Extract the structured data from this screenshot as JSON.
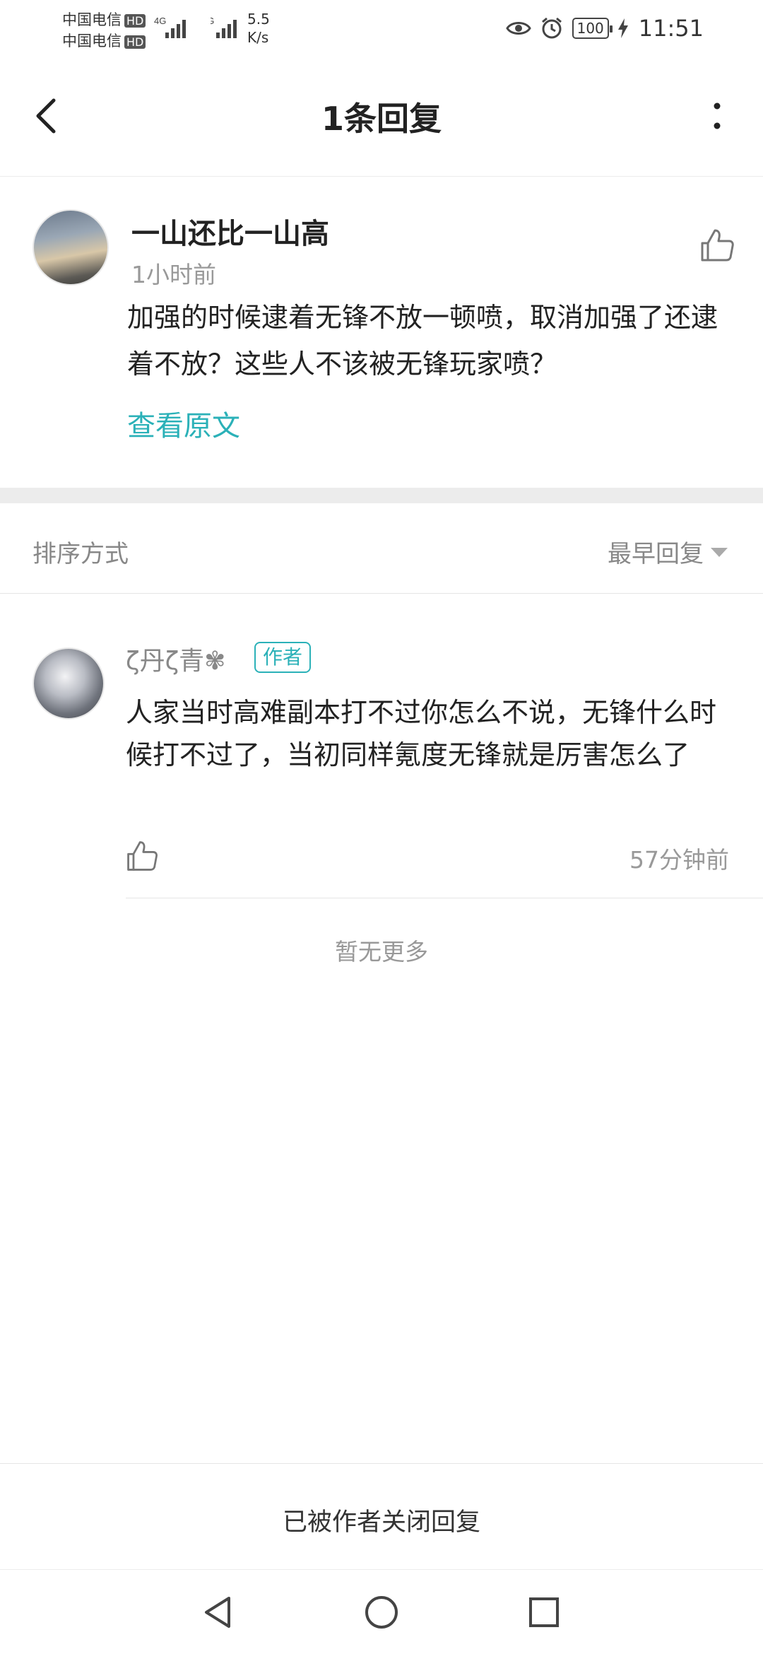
{
  "status_bar": {
    "carrier_1": "中国电信",
    "carrier_2": "中国电信",
    "hd_label": "HD",
    "network_1": "4G",
    "network_2": "4G",
    "speed_value": "5.5",
    "speed_unit": "K/s",
    "battery": "100",
    "time": "11:51",
    "icons": [
      "eye-icon",
      "alarm-icon",
      "battery-icon",
      "charging-icon"
    ]
  },
  "header": {
    "title": "1条回复"
  },
  "original_comment": {
    "author": "一山还比一山高",
    "time": "1小时前",
    "text": "加强的时候逮着无锋不放一顿喷，取消加强了还逮着不放？这些人不该被无锋玩家喷？",
    "view_original": "查看原文"
  },
  "sort": {
    "label": "排序方式",
    "selected": "最早回复"
  },
  "replies": [
    {
      "author": "ζ丹ζ青✾",
      "badge": "作者",
      "text": "人家当时高难副本打不过你怎么不说，无锋什么时候打不过了，当初同样氪度无锋就是厉害怎么了",
      "time": "57分钟前"
    }
  ],
  "no_more": "暂无更多",
  "footer": {
    "closed_notice": "已被作者关闭回复"
  },
  "colors": {
    "accent": "#2bb1b8",
    "muted_text": "#999999",
    "divider": "#ececec"
  }
}
